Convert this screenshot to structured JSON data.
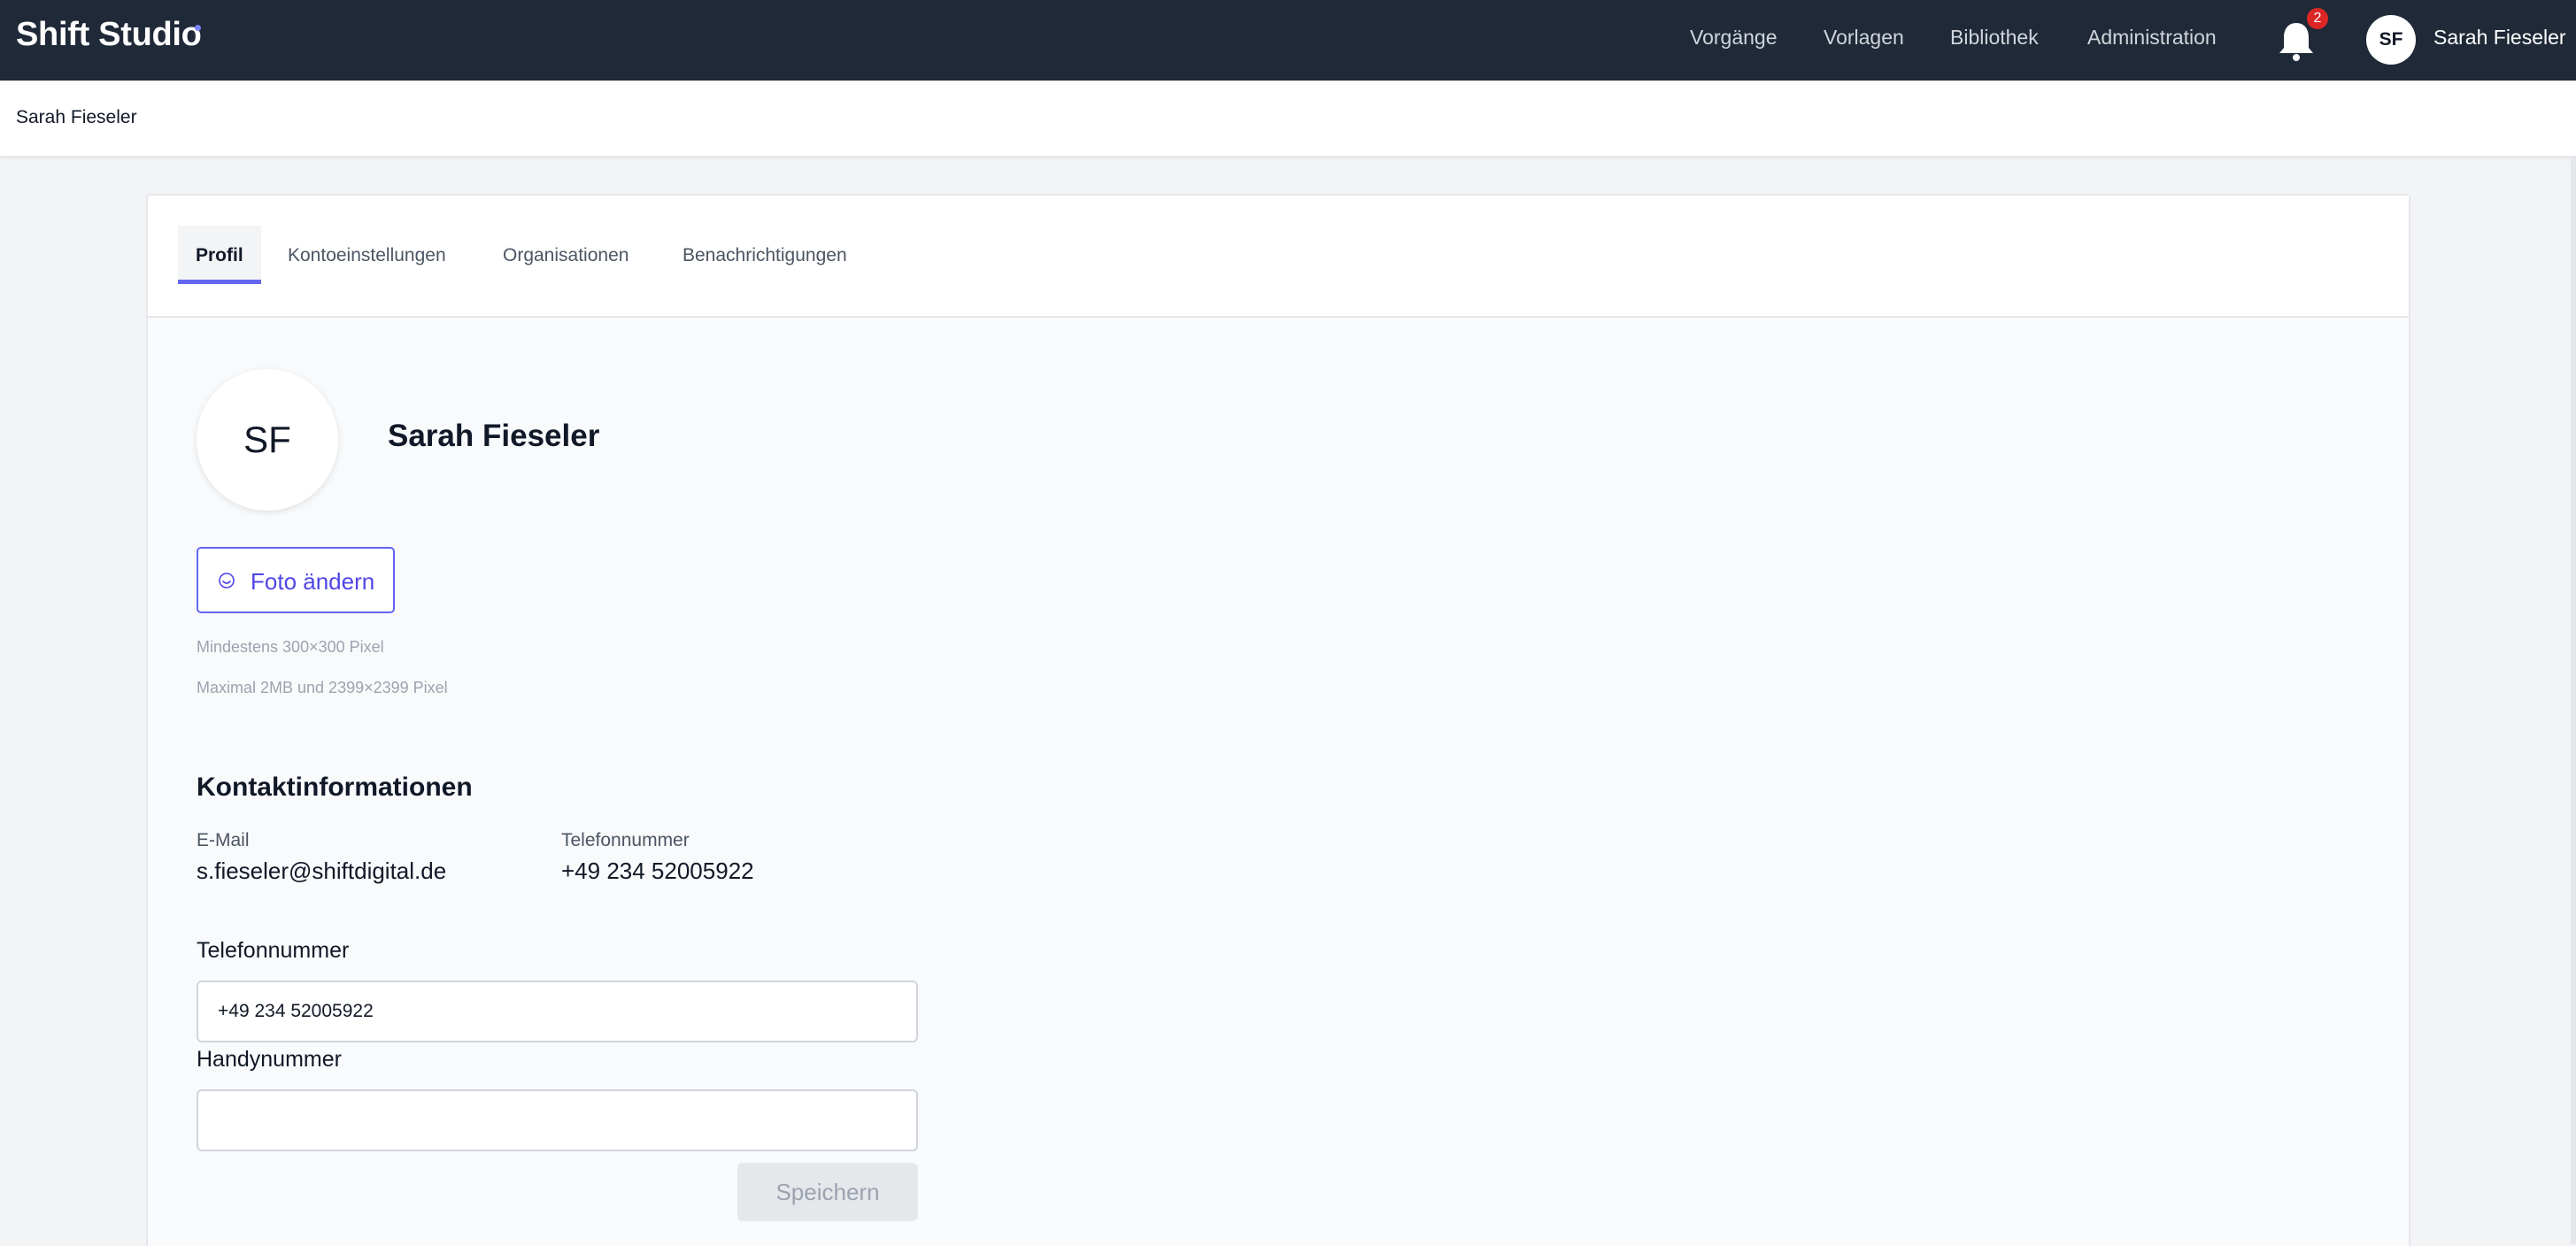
{
  "app": {
    "name": "Shift Studio"
  },
  "nav": {
    "links": [
      "Vorgänge",
      "Vorlagen",
      "Bibliothek",
      "Administration"
    ],
    "notifications_count": "2",
    "user_initials": "SF",
    "user_name": "Sarah Fieseler"
  },
  "breadcrumb": "Sarah Fieseler",
  "tabs": [
    "Profil",
    "Kontoeinstellungen",
    "Organisationen",
    "Benachrichtigungen"
  ],
  "active_tab": "Profil",
  "profile": {
    "initials": "SF",
    "name": "Sarah Fieseler",
    "change_photo_label": "Foto ändern",
    "hint_min": "Mindestens 300×300 Pixel",
    "hint_max": "Maximal 2MB und 2399×2399 Pixel"
  },
  "contact": {
    "title": "Kontaktinformationen",
    "email_label": "E-Mail",
    "email_value": "s.fieseler@shiftdigital.de",
    "phone_label": "Telefonnummer",
    "phone_value": "+49 234 52005922"
  },
  "form": {
    "phone_label": "Telefonnummer",
    "phone_value": "+49 234 52005922",
    "mobile_label": "Handynummer",
    "mobile_value": "",
    "save_label": "Speichern"
  },
  "colors": {
    "nav_bg": "#1f2937",
    "accent": "#6366f1",
    "badge": "#dc2626"
  },
  "icons": {
    "bell": "bell-icon",
    "photo": "smiley-icon"
  }
}
